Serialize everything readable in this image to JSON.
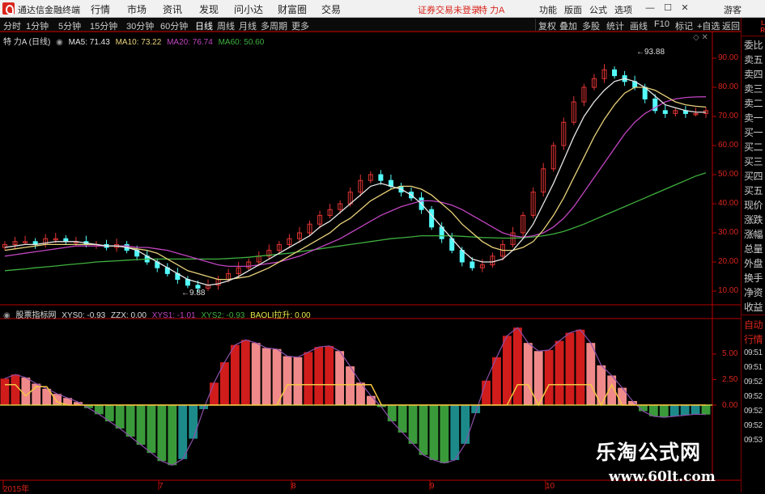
{
  "app": {
    "name": "通达信金融终端"
  },
  "menu": [
    "行情",
    "市场",
    "资讯",
    "发现",
    "问小达",
    "财富圈",
    "交易"
  ],
  "status_notice": "证券交易未登录",
  "stock_name": "特 力A",
  "right_menu": [
    "功能",
    "版面",
    "公式",
    "选项"
  ],
  "guest_label": "游客",
  "timeframes": [
    "分时",
    "1分钟",
    "5分钟",
    "15分钟",
    "30分钟",
    "60分钟",
    "日线",
    "周线",
    "月线",
    "多周期",
    "更多"
  ],
  "selected_timeframe": "日线",
  "toolbar_right": [
    "复权",
    "叠加",
    "多股",
    "统计",
    "画线",
    "F10",
    "标记",
    "+自选",
    "返回"
  ],
  "main_legend": {
    "title": "特 力A (日线)",
    "ma5": "MA5: 71.43",
    "ma10": "MA10: 73.22",
    "ma20": "MA20: 76.74",
    "ma60": "MA60: 50.60"
  },
  "sub_legend": {
    "title": "股票指标网",
    "xys0": "XYS0: -0.93",
    "zzx": "ZZX: 0.00",
    "xys1": "XYS1: -1.01",
    "xys2": "XYS2: -0.93",
    "baoli": "BAOLI拉升: 0.00"
  },
  "annotations": {
    "high": "93.88",
    "low": "9.88"
  },
  "main_yaxis": [
    "90.00",
    "80.00",
    "70.00",
    "60.00",
    "50.00",
    "40.00",
    "30.00",
    "20.00",
    "10.00"
  ],
  "sub_yaxis": [
    "5.00",
    "2.50",
    "0.00"
  ],
  "xaxis": [
    "2015年",
    "7",
    "8",
    "9",
    "10"
  ],
  "side_panel": {
    "top": [
      "委比",
      "卖五",
      "卖四",
      "卖三",
      "卖二",
      "卖一",
      "买一",
      "买二",
      "买三",
      "买四",
      "买五",
      "现价",
      "涨跌",
      "涨幅",
      "总量",
      "外盘",
      "换手",
      "净资",
      "收益"
    ],
    "bottom": [
      "自动",
      "行情",
      "09:51",
      "09:51",
      "09:52",
      "09:52",
      "09:52",
      "09:52",
      "09:53"
    ],
    "markers": [
      "L",
      "R"
    ]
  },
  "colors": {
    "up": "#e23434",
    "down": "#54fcfc",
    "ma5": "#e6e6e6",
    "ma10": "#e8d27a",
    "ma20": "#c045c0",
    "ma60": "#3fb03f",
    "axis": "#b80000"
  },
  "watermark": {
    "cn": "乐淘公式网",
    "url": "www.60lt.com"
  },
  "chart_data": {
    "type": "line",
    "main_panel": {
      "ylim": [
        5,
        97
      ],
      "high_value": 93.88,
      "low_value": 9.88,
      "close": [
        26,
        27,
        27,
        26,
        28,
        28,
        27,
        27,
        26,
        26,
        25,
        26,
        24,
        22,
        20,
        18,
        16,
        14,
        12,
        11,
        12,
        14,
        16,
        18,
        20,
        22,
        24,
        26,
        28,
        30,
        33,
        36,
        38,
        40,
        44,
        48,
        50,
        48,
        46,
        44,
        42,
        38,
        32,
        28,
        24,
        20,
        18,
        19,
        22,
        26,
        30,
        36,
        44,
        52,
        60,
        68,
        75,
        80,
        83,
        86,
        84,
        82,
        80,
        76,
        72,
        71,
        72,
        71,
        71,
        72
      ],
      "ma5": [
        25,
        25.5,
        26,
        26,
        26.5,
        27,
        27,
        27,
        26.5,
        26,
        25.5,
        25.5,
        25,
        24,
        22,
        20,
        18,
        16,
        14,
        13,
        12,
        12.5,
        13.5,
        15,
        17,
        19,
        21,
        23,
        25,
        27,
        29,
        32,
        34,
        37,
        40,
        43,
        46,
        47,
        46,
        45,
        43,
        40,
        36,
        32,
        28,
        24,
        21,
        20,
        20,
        21,
        24,
        28,
        33,
        40,
        47,
        55,
        63,
        70,
        75,
        79,
        82,
        83,
        82,
        80,
        77,
        74,
        73,
        72,
        71.5,
        71.43
      ],
      "ma10": [
        24,
        24.5,
        25,
        25.5,
        26,
        26,
        26,
        26,
        26,
        26,
        25.5,
        25.5,
        25,
        24.5,
        24,
        23,
        21,
        19,
        17,
        16,
        15,
        14,
        14,
        14.5,
        15,
        16.5,
        18,
        20,
        22,
        24,
        26,
        28,
        30,
        33,
        35,
        38,
        41,
        43,
        45,
        46,
        46,
        45,
        43,
        40,
        37,
        33,
        30,
        27,
        25,
        24,
        24,
        25,
        27,
        31,
        36,
        42,
        49,
        56,
        63,
        69,
        74,
        78,
        80,
        80,
        79,
        77,
        75,
        74,
        73.5,
        73.22
      ],
      "ma20": [
        22,
        22.5,
        23,
        23.5,
        24,
        24.5,
        25,
        25.5,
        25.5,
        25.5,
        25.5,
        25.5,
        25.5,
        25,
        25,
        24.5,
        24,
        23,
        22,
        21,
        20,
        19,
        18.5,
        18.5,
        18.5,
        19,
        19.5,
        20,
        21,
        22,
        23.5,
        25,
        26.5,
        28,
        30,
        32,
        34,
        36,
        37.5,
        39,
        40,
        41,
        41,
        40.5,
        39.5,
        38,
        36,
        34,
        32,
        30,
        29,
        28.5,
        29,
        30,
        32,
        35,
        39,
        44,
        49,
        54,
        59,
        64,
        68,
        71,
        73,
        75,
        76,
        76.5,
        76.7,
        76.74
      ],
      "ma60": [
        17,
        17.3,
        17.6,
        18,
        18.3,
        18.6,
        19,
        19.3,
        19.6,
        20,
        20.2,
        20.4,
        20.6,
        20.8,
        21,
        21,
        21,
        21,
        21,
        21,
        21,
        21,
        21.2,
        21.4,
        21.6,
        22,
        22.3,
        22.7,
        23,
        23.5,
        24,
        24.5,
        25,
        25.5,
        26,
        26.5,
        27,
        27.5,
        28,
        28.3,
        28.6,
        29,
        29,
        29,
        29,
        28.8,
        28.6,
        28.4,
        28.3,
        28.2,
        28.2,
        28.3,
        28.6,
        29,
        29.6,
        30.5,
        31.7,
        33,
        34.5,
        36,
        37.5,
        39,
        40.5,
        42,
        43.5,
        45,
        46.5,
        48,
        49.5,
        50.6
      ]
    },
    "sub_panel": {
      "ylim": [
        -6.5,
        8
      ],
      "histogram": [
        2.6,
        3.0,
        2.7,
        2.1,
        1.6,
        1.1,
        0.7,
        0.3,
        -0.3,
        -0.9,
        -1.6,
        -2.3,
        -3.1,
        -3.9,
        -4.7,
        -5.5,
        -5.9,
        -5.3,
        -3.3,
        -0.4,
        2.2,
        4.2,
        5.9,
        6.4,
        6.1,
        5.6,
        5.5,
        4.8,
        4.7,
        5.2,
        5.7,
        5.8,
        5.3,
        3.8,
        2.2,
        0.9,
        -0.2,
        -1.6,
        -2.7,
        -3.8,
        -4.9,
        -5.4,
        -5.7,
        -5.4,
        -3.8,
        -0.8,
        2.4,
        4.7,
        6.8,
        7.6,
        6.1,
        5.3,
        5.4,
        6.3,
        7.1,
        7.4,
        6.1,
        3.9,
        2.9,
        1.7,
        0.4,
        -0.6,
        -1.1,
        -1.2,
        -1.1,
        -1.0,
        -0.9,
        -0.93
      ],
      "signal_line": [
        2.0,
        2.0,
        0.9,
        1.8,
        1.8,
        0.3,
        0,
        0,
        0,
        0,
        0,
        0,
        0,
        0,
        0,
        0,
        0,
        0,
        0,
        0,
        0,
        0,
        0,
        0,
        0,
        0,
        0,
        2.0,
        2.0,
        2.0,
        2.0,
        2.0,
        2.0,
        2.0,
        2.0,
        2.0,
        0,
        0,
        0,
        0,
        0,
        0,
        0,
        0,
        0,
        0,
        0,
        0,
        0,
        2.0,
        2.0,
        0,
        2.0,
        2.0,
        2.0,
        2.0,
        2.0,
        0,
        2.0,
        0,
        0,
        0,
        0,
        0,
        0,
        0,
        0,
        0
      ]
    },
    "xlabels": [
      "2015年",
      "7",
      "8",
      "9",
      "10"
    ]
  }
}
